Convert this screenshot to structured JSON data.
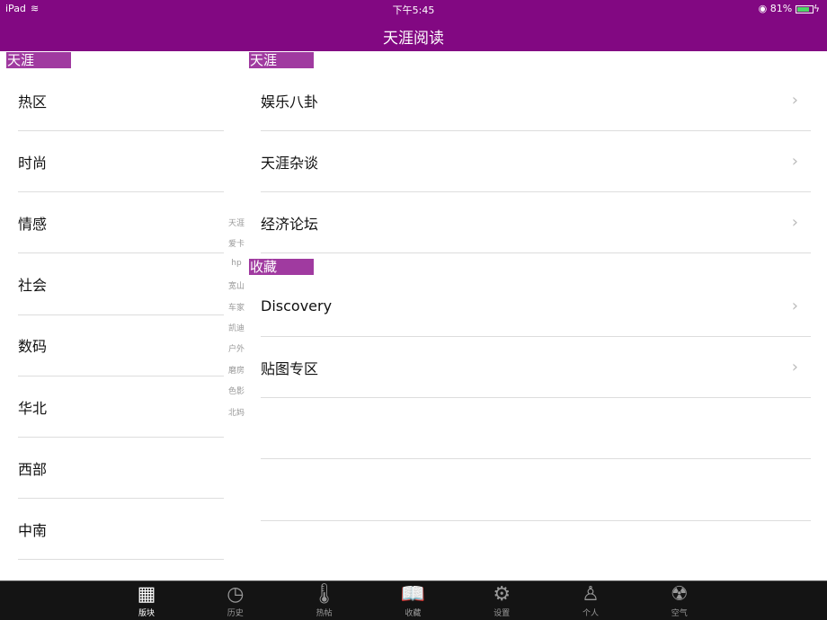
{
  "status": {
    "device": "iPad",
    "time": "下午5:45",
    "battery": "81%",
    "battery_level": 0.81
  },
  "nav": {
    "title": "天涯阅读"
  },
  "left": {
    "section": "天涯",
    "items": [
      "热区",
      "时尚",
      "情感",
      "社会",
      "数码",
      "华北",
      "西部",
      "中南"
    ]
  },
  "right": {
    "sections": [
      {
        "title": "天涯",
        "items": [
          "娱乐八卦",
          "天涯杂谈",
          "经济论坛"
        ]
      },
      {
        "title": "收藏",
        "items": [
          "Discovery",
          "贴图专区"
        ]
      }
    ]
  },
  "index": [
    "天涯",
    "爱卡",
    "hp",
    "宽山",
    "车家",
    "凯迪",
    "户外",
    "磨房",
    "色影",
    "北妈"
  ],
  "tabs": [
    {
      "label": "版块",
      "icon": "calendar-icon"
    },
    {
      "label": "历史",
      "icon": "clock-icon"
    },
    {
      "label": "热帖",
      "icon": "thermometer-icon"
    },
    {
      "label": "收藏",
      "icon": "book-icon"
    },
    {
      "label": "设置",
      "icon": "gear-icon"
    },
    {
      "label": "个人",
      "icon": "person-icon"
    },
    {
      "label": "空气",
      "icon": "radiation-icon"
    }
  ],
  "colors": {
    "nav": "#820882",
    "section": "#a03aa0",
    "tabbar": "#141414"
  }
}
